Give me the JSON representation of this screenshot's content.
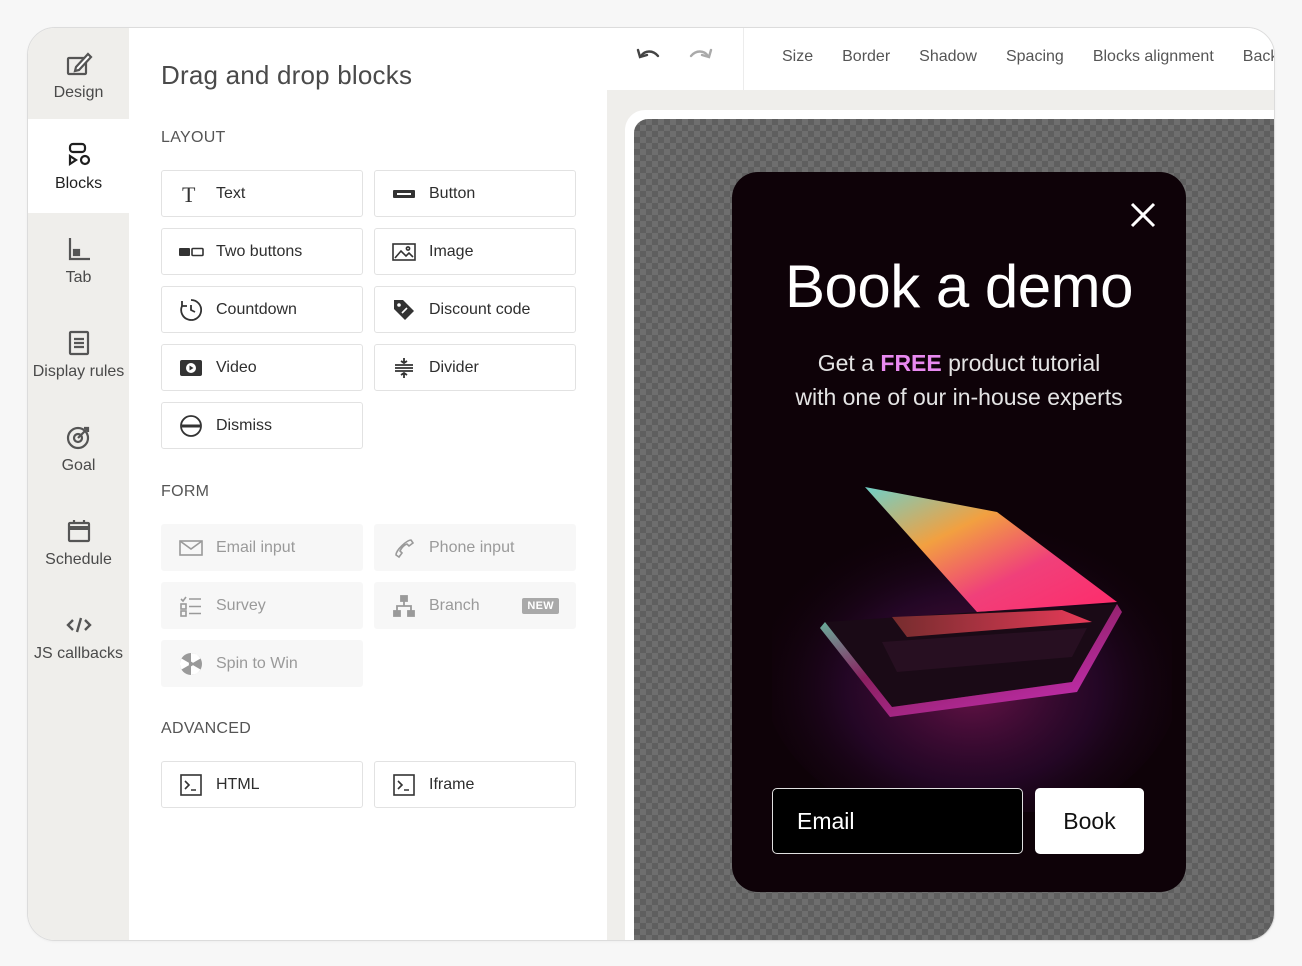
{
  "rail": {
    "items": [
      {
        "label": "Design",
        "icon": "edit-icon"
      },
      {
        "label": "Blocks",
        "icon": "blocks-icon"
      },
      {
        "label": "Tab",
        "icon": "tab-icon"
      },
      {
        "label": "Display rules",
        "icon": "list-icon"
      },
      {
        "label": "Goal",
        "icon": "target-icon"
      },
      {
        "label": "Schedule",
        "icon": "calendar-icon"
      },
      {
        "label": "JS callbacks",
        "icon": "code-icon"
      }
    ],
    "active": "Blocks"
  },
  "panel": {
    "title": "Drag and drop blocks",
    "layout_heading": "LAYOUT",
    "layout": [
      "Text",
      "Button",
      "Two buttons",
      "Image",
      "Countdown",
      "Discount code",
      "Video",
      "Divider",
      "Dismiss"
    ],
    "form_heading": "FORM",
    "form": [
      "Email input",
      "Phone input",
      "Survey",
      "Branch",
      "Spin to Win"
    ],
    "branch_badge": "NEW",
    "advanced_heading": "ADVANCED",
    "advanced": [
      "HTML",
      "Iframe"
    ]
  },
  "toolbar": {
    "tabs": [
      "Size",
      "Border",
      "Shadow",
      "Spacing",
      "Blocks alignment",
      "Back"
    ]
  },
  "popup": {
    "title": "Book a demo",
    "sub_prefix": "Get a ",
    "sub_free": "FREE",
    "sub_suffix": " product tutorial",
    "sub_line2": "with one of our in-house experts",
    "email_placeholder": "Email",
    "book_label": "Book",
    "accent_color": "#e889f0"
  }
}
